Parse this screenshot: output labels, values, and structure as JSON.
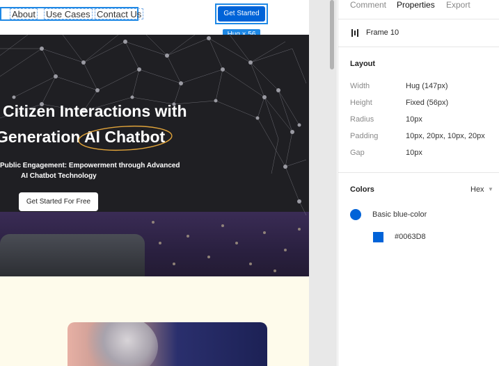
{
  "canvas": {
    "nav": {
      "about": "About",
      "use_cases": "Use Cases",
      "contact": "Contact Us"
    },
    "cta_button": "Get Started",
    "hug_badge": "Hug × 56",
    "hero": {
      "heading_line1": "Citizen Interactions with",
      "heading_line2": "Generation AI Chatbot",
      "subheading_line1": "Public Engagement: Empowerment through Advanced",
      "subheading_line2": "AI Chatbot Technology",
      "button": "Get Started For Free"
    }
  },
  "panel": {
    "tabs": [
      "Comment",
      "Properties",
      "Export"
    ],
    "active_tab": "Properties",
    "frame_name": "Frame 10",
    "layout": {
      "title": "Layout",
      "rows": [
        {
          "label": "Width",
          "value": "Hug (147px)"
        },
        {
          "label": "Height",
          "value": "Fixed (56px)"
        },
        {
          "label": "Radius",
          "value": "10px"
        },
        {
          "label": "Padding",
          "value": "10px, 20px, 10px, 20px"
        },
        {
          "label": "Gap",
          "value": "10px"
        }
      ]
    },
    "colors": {
      "title": "Colors",
      "format": "Hex",
      "name": "Basic blue-color",
      "hex": "#0063D8"
    }
  },
  "icons": [
    "frame-layout-icon",
    "chevron-down-icon"
  ],
  "accent_color": "#0063D8",
  "selection_color": "#1e88e5"
}
